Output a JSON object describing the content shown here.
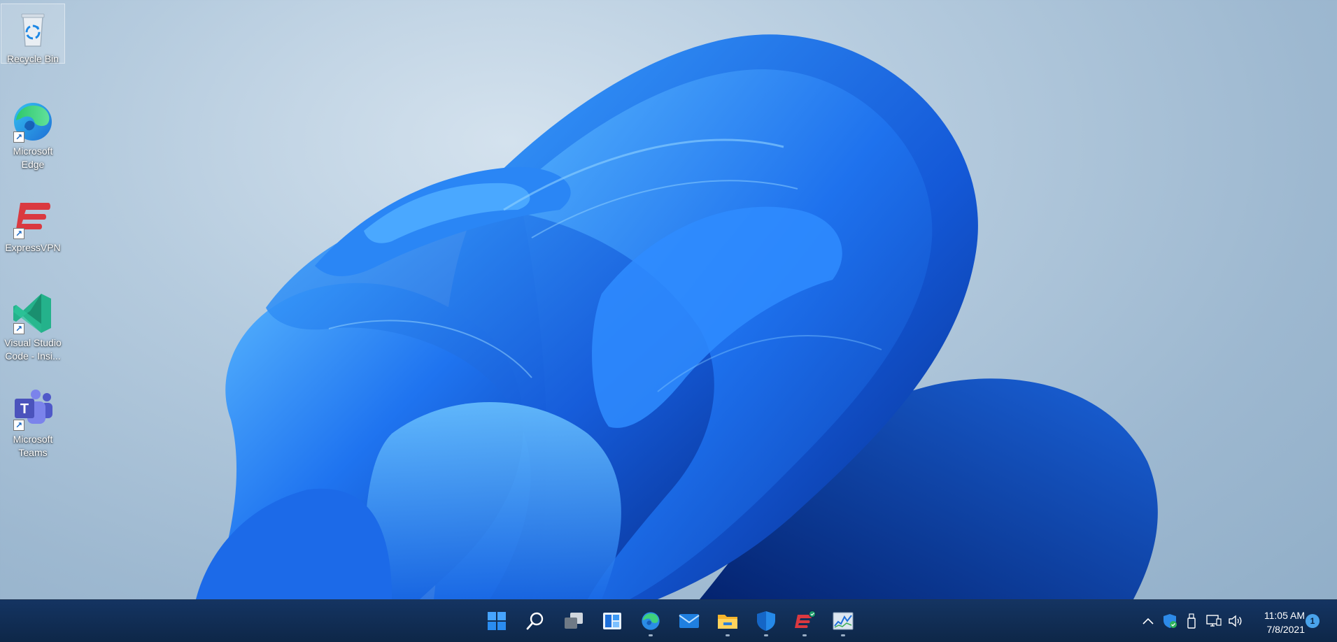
{
  "desktop": {
    "icons": [
      {
        "label": "Recycle Bin",
        "icon": "recycle-bin-icon"
      },
      {
        "label": "Microsoft Edge",
        "icon": "edge-icon"
      },
      {
        "label": "ExpressVPN",
        "icon": "expressvpn-icon"
      },
      {
        "label": "Visual Studio Code - Insi...",
        "icon": "vscode-insiders-icon"
      },
      {
        "label": "Microsoft Teams",
        "icon": "teams-icon"
      }
    ]
  },
  "taskbar": {
    "apps": [
      {
        "icon": "start-icon"
      },
      {
        "icon": "search-icon"
      },
      {
        "icon": "task-view-icon"
      },
      {
        "icon": "widgets-icon"
      },
      {
        "icon": "edge-icon"
      },
      {
        "icon": "mail-icon"
      },
      {
        "icon": "file-explorer-icon"
      },
      {
        "icon": "windows-security-icon"
      },
      {
        "icon": "expressvpn-icon"
      },
      {
        "icon": "resource-monitor-icon"
      }
    ],
    "tray": {
      "icons": [
        "chevron-up-icon",
        "security-shield-icon",
        "usb-drive-icon",
        "network-icon",
        "volume-icon"
      ],
      "time": "11:05 AM",
      "date": "7/8/2021",
      "notification_count": "1"
    }
  },
  "colors": {
    "taskbar": "#0f2a4e",
    "accent": "#0a6cff"
  }
}
